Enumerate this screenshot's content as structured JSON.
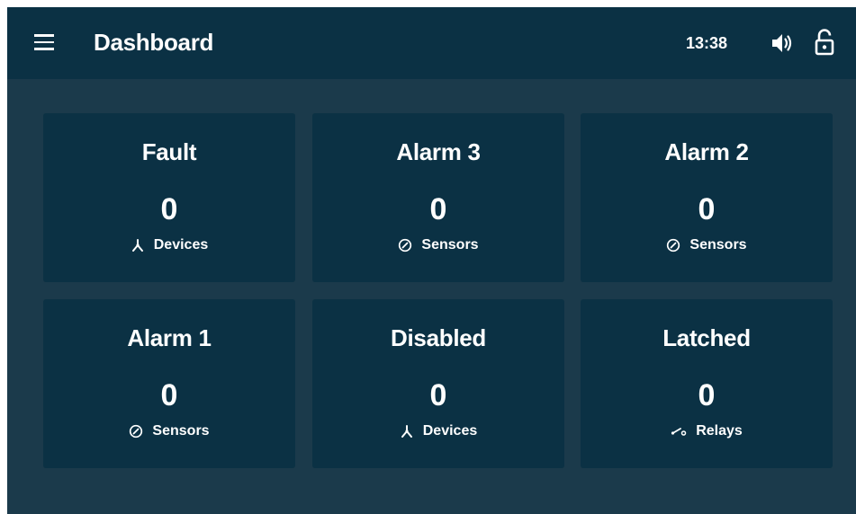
{
  "header": {
    "title": "Dashboard",
    "time": "13:38"
  },
  "tiles": [
    {
      "label": "Fault",
      "count": "0",
      "sub_label": "Devices",
      "icon": "devices-icon"
    },
    {
      "label": "Alarm 3",
      "count": "0",
      "sub_label": "Sensors",
      "icon": "sensor-gauge-icon"
    },
    {
      "label": "Alarm 2",
      "count": "0",
      "sub_label": "Sensors",
      "icon": "sensor-gauge-icon"
    },
    {
      "label": "Alarm 1",
      "count": "0",
      "sub_label": "Sensors",
      "icon": "sensor-gauge-icon"
    },
    {
      "label": "Disabled",
      "count": "0",
      "sub_label": "Devices",
      "icon": "devices-icon"
    },
    {
      "label": "Latched",
      "count": "0",
      "sub_label": "Relays",
      "icon": "relay-icon"
    }
  ],
  "colors": {
    "background": "#1b3a4b",
    "topbar": "#0b3144",
    "tile": "#0b3144",
    "text": "#ffffff"
  }
}
